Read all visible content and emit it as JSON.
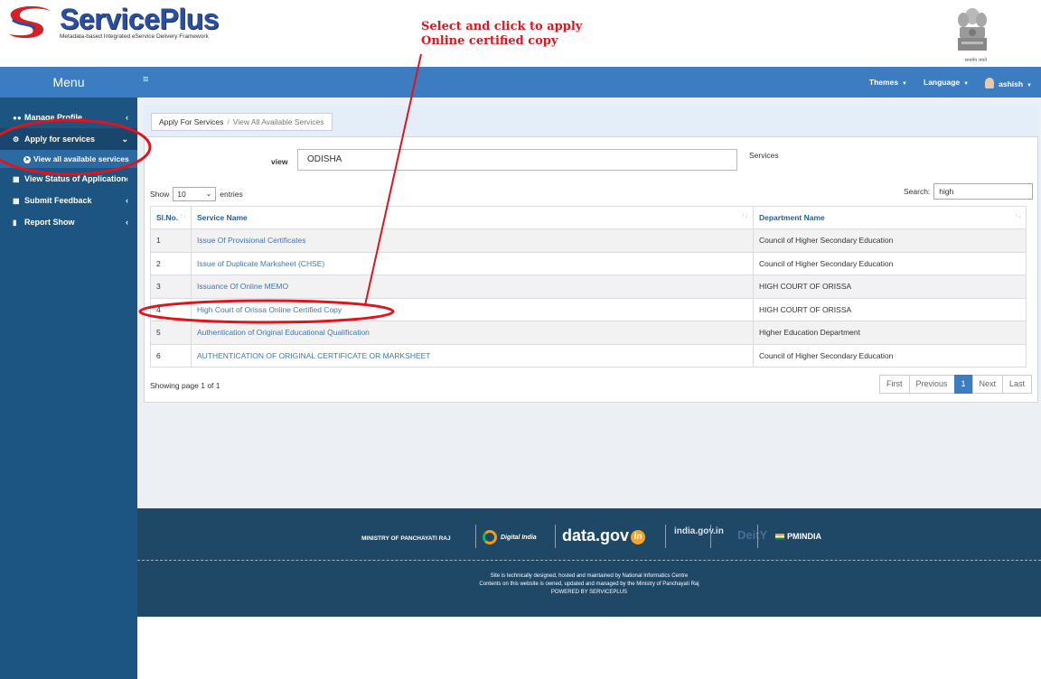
{
  "header": {
    "brand": "ServicePlus",
    "tagline": "Metadata-based Integrated eService Delivery Framework",
    "emblem_caption": "सत्यमेव जयते"
  },
  "annotation": {
    "line1": "Select and click to apply",
    "line2": "Online certified copy",
    "color": "#e0141e"
  },
  "sidebar": {
    "title": "Menu",
    "items": [
      {
        "label": "Manage Profile",
        "icon": "users-icon"
      },
      {
        "label": "Apply for services",
        "icon": "cogs-icon"
      },
      {
        "label": "View all available services",
        "icon": "arrow-circle-icon"
      },
      {
        "label": "View Status of Application",
        "icon": "document-icon"
      },
      {
        "label": "Submit Feedback",
        "icon": "document-icon"
      },
      {
        "label": "Report Show",
        "icon": "file-icon"
      }
    ]
  },
  "navbar": {
    "menu_icon": "≡",
    "themes": "Themes",
    "language": "Language",
    "user": "ashish"
  },
  "breadcrumb": {
    "parent": "Apply For Services",
    "current": "View All Available Services"
  },
  "filter": {
    "view_label": "view",
    "view_value": "ODISHA",
    "services_label": "Services"
  },
  "table_controls": {
    "show_label": "Show",
    "page_length": "10",
    "entries_label": "entries",
    "search_label": "Search:",
    "search_value": "high"
  },
  "table": {
    "columns": [
      "Sl.No.",
      "Service Name",
      "Department Name"
    ],
    "rows": [
      {
        "sl": "1",
        "service": "Issue Of Provisional Certificates",
        "dept": "Council of Higher Secondary Education"
      },
      {
        "sl": "2",
        "service": "Issue of Duplicate Marksheet (CHSE)",
        "dept": "Council of Higher Secondary Education"
      },
      {
        "sl": "3",
        "service": "Issuance Of Online MEMO",
        "dept": "HIGH COURT OF ORISSA"
      },
      {
        "sl": "4",
        "service": "High Court of Orissa Online Certified Copy",
        "dept": "HIGH COURT OF ORISSA"
      },
      {
        "sl": "5",
        "service": "Authentication of Original Educational Qualification",
        "dept": "Higher Education Department"
      },
      {
        "sl": "6",
        "service": "AUTHENTICATION OF ORIGINAL CERTIFICATE OR MARKSHEET",
        "dept": "Council of Higher Secondary Education"
      }
    ]
  },
  "pagination": {
    "info": "Showing page 1 of 1",
    "first": "First",
    "previous": "Previous",
    "current": "1",
    "next": "Next",
    "last": "Last"
  },
  "footer": {
    "logos": [
      "MINISTRY OF PANCHAYATI RAJ",
      "Digital India",
      "data.gov",
      "india.gov.in",
      "DeitY",
      "PMINDIA"
    ],
    "line1": "Site is technically designed, hosted and maintained by National Informatics Centre",
    "line2": "Contents on this website is owned, updated and managed by the Ministry of Panchayati Raj",
    "line3": "POWERED BY SERVICEPLUS"
  }
}
